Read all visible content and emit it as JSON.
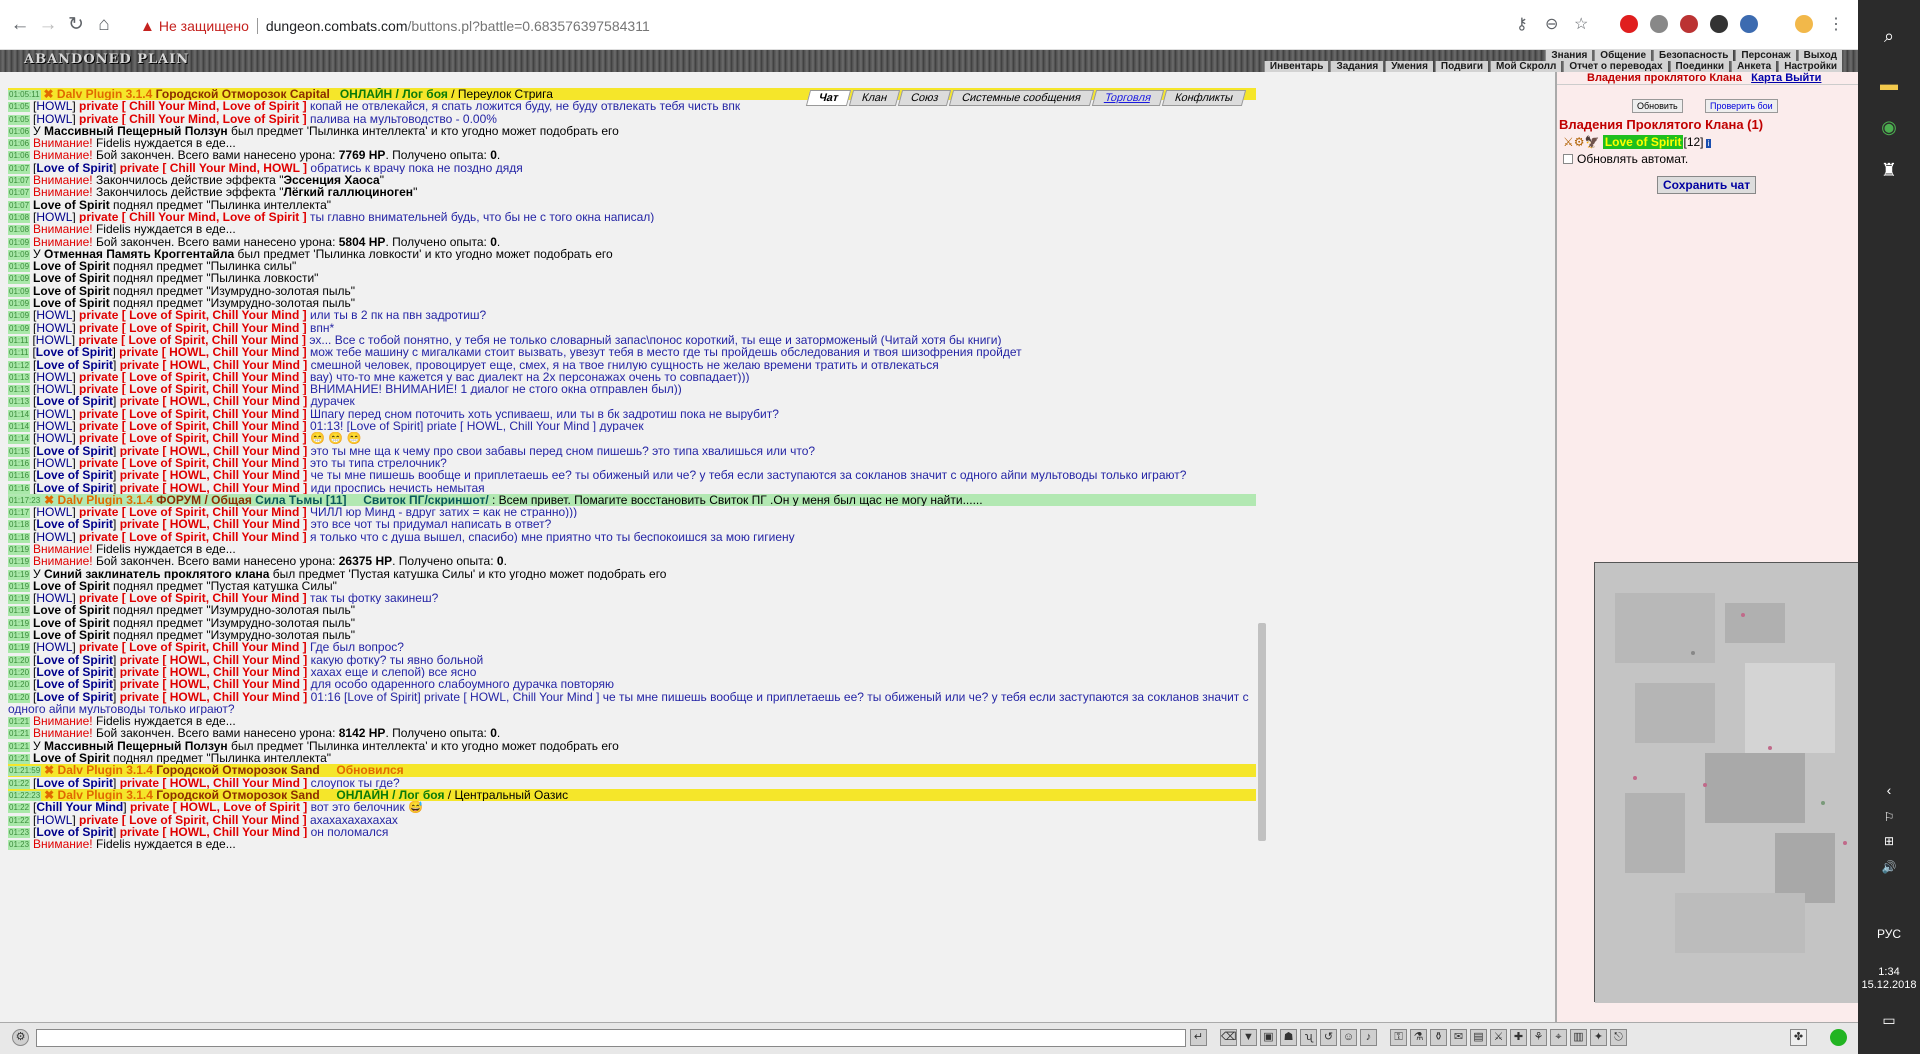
{
  "browser": {
    "not_secure": "Не защищено",
    "url_host": "dungeon.combats.com",
    "url_rest": "/buttons.pl?battle=0.683576397584311"
  },
  "game": {
    "logo": "ABANDONED PLAIN",
    "menu_row1": [
      "Знания",
      "Общение",
      "Безопасность",
      "Персонаж",
      "Выход"
    ],
    "menu_row2": [
      "Инвентарь",
      "Задания",
      "Умения",
      "Подвиги",
      "Мой Скролл",
      "Отчет о переводах",
      "Поединки",
      "Анкета",
      "Настройки"
    ]
  },
  "tabs": [
    "Чат",
    "Клан",
    "Союз",
    "Системные сообщения",
    "Торговля",
    "Конфликты"
  ],
  "chat": [
    {
      "t": "01:05:11",
      "cls": "hl",
      "html": "<span class='orn'>✖ Dalv Plugin 3.1.4</span> <span class='drk'>Городской Отморозок Capital</span> &nbsp; <span class='grn'>ОНЛАЙН / Лог боя</span> / Переулок Стрига"
    },
    {
      "t": "01:05",
      "html": "[<span class='nm'>HOWL</span>] <span class='red'>private [ Chill Your Mind, Love of Spirit ]</span> <span class='blue'>копай не отвлекайся, я спать ложится буду, не буду отвлекать тебя чисть впк</span>"
    },
    {
      "t": "01:05",
      "html": "[<span class='nm'>HOWL</span>] <span class='red'>private [ Chill Your Mind, Love of Spirit ]</span> <span class='blue'>палива на мультоводство - 0.00%</span>"
    },
    {
      "t": "01:06",
      "html": "У <b>Массивный Пещерный Ползун</b> был предмет 'Пылинка интеллекта' и кто угодно может подобрать его"
    },
    {
      "t": "01:06",
      "html": "<span class='red2'>Внимание!</span> Fidelis нуждается в еде..."
    },
    {
      "t": "01:06",
      "html": "<span class='red2'>Внимание!</span> Бой закончен. Всего вами нанесено урона: <b>7769 HP</b>. Получено опыта: <b>0</b>."
    },
    {
      "t": "01:07",
      "html": "[<span class='nm b'>Love of Spirit</span>] <span class='red'>private [ Chill Your Mind, HOWL ]</span> <span class='blue'>обратись к врачу пока не поздно дядя</span>"
    },
    {
      "t": "01:07",
      "html": "<span class='red2'>Внимание!</span> Закончилось действие эффекта \"<b>Эссенция Хаоса</b>\""
    },
    {
      "t": "01:07",
      "html": "<span class='red2'>Внимание!</span> Закончилось действие эффекта \"<b>Лёгкий галлюциноген</b>\""
    },
    {
      "t": "01:07",
      "html": "<b>Love of Spirit</b> поднял предмет \"Пылинка интеллекта\""
    },
    {
      "t": "01:08",
      "html": "[<span class='nm'>HOWL</span>] <span class='red'>private [ Chill Your Mind, Love of Spirit ]</span> <span class='blue'>ты главно внимательней будь, что бы не с того окна написал)</span>"
    },
    {
      "t": "01:08",
      "html": "<span class='red2'>Внимание!</span> Fidelis нуждается в еде..."
    },
    {
      "t": "01:09",
      "html": "<span class='red2'>Внимание!</span> Бой закончен. Всего вами нанесено урона: <b>5804 HP</b>. Получено опыта: <b>0</b>."
    },
    {
      "t": "01:09",
      "html": "У <b>Отменная Память Кроггентайла</b> был предмет 'Пылинка ловкости' и кто угодно может подобрать его"
    },
    {
      "t": "01:09",
      "html": "<b>Love of Spirit</b> поднял предмет \"Пылинка силы\""
    },
    {
      "t": "01:09",
      "html": "<b>Love of Spirit</b> поднял предмет \"Пылинка ловкости\""
    },
    {
      "t": "01:09",
      "html": "<b>Love of Spirit</b> поднял предмет \"Изумрудно-золотая пыль\""
    },
    {
      "t": "01:09",
      "html": "<b>Love of Spirit</b> поднял предмет \"Изумрудно-золотая пыль\""
    },
    {
      "t": "01:09",
      "html": "[<span class='nm'>HOWL</span>] <span class='red'>private [ Love of Spirit, Chill Your Mind ]</span> <span class='blue'>или ты в 2 пк на пвн задротиш?</span>"
    },
    {
      "t": "01:09",
      "html": "[<span class='nm'>HOWL</span>] <span class='red'>private [ Love of Spirit, Chill Your Mind ]</span> <span class='blue'>впн*</span>"
    },
    {
      "t": "01:11",
      "html": "[<span class='nm'>HOWL</span>] <span class='red'>private [ Love of Spirit, Chill Your Mind ]</span> <span class='blue'>эх... Все с тобой понятно, у тебя не только словарный запас\\понос короткий, ты еще и заторможеный (Читай хотя бы книги)</span>"
    },
    {
      "t": "01:11",
      "html": "[<span class='nm b'>Love of Spirit</span>] <span class='red'>private [ HOWL, Chill Your Mind ]</span> <span class='blue'>мож тебе машину с мигалками стоит вызвать, увезут тебя в место где ты пройдешь обследования и твоя шизофрения пройдет</span>"
    },
    {
      "t": "01:12",
      "html": "[<span class='nm b'>Love of Spirit</span>] <span class='red'>private [ HOWL, Chill Your Mind ]</span> <span class='blue'>смешной человек, провоцирует еще, смех, я на твое гнилую сущность не желаю времени тратить и отвлекаться</span>"
    },
    {
      "t": "01:13",
      "html": "[<span class='nm'>HOWL</span>] <span class='red'>private [ Love of Spirit, Chill Your Mind ]</span> <span class='blue'>вау) что-то мне кажется у вас диалект на 2х персонажах очень то совпадает)))</span>"
    },
    {
      "t": "01:13",
      "html": "[<span class='nm'>HOWL</span>] <span class='red'>private [ Love of Spirit, Chill Your Mind ]</span> <span class='blue'>ВНИМАНИЕ! ВНИМАНИЕ! 1 диалог не стого окна отправлен был))</span>"
    },
    {
      "t": "01:13",
      "html": "[<span class='nm b'>Love of Spirit</span>] <span class='red'>private [ HOWL, Chill Your Mind ]</span> <span class='blue'>дурачек</span>"
    },
    {
      "t": "01:14",
      "html": "[<span class='nm'>HOWL</span>] <span class='red'>private [ Love of Spirit, Chill Your Mind ]</span> <span class='blue'>Шпагу перед сном поточить хоть успиваеш, или ты в бк задротиш пока не вырубит?</span>"
    },
    {
      "t": "01:14",
      "html": "[<span class='nm'>HOWL</span>] <span class='red'>private [ Love of Spirit, Chill Your Mind ]</span> <span class='blue'>01:13! [Love of Spirit] priate [ HOWL, Chill Your Mind ] дурачек</span>"
    },
    {
      "t": "01:14",
      "html": "[<span class='nm'>HOWL</span>] <span class='red'>private [ Love of Spirit, Chill Your Mind ]</span> <span style='color:#1a8a8a'>😁 😁 😁</span>"
    },
    {
      "t": "01:15",
      "html": "[<span class='nm b'>Love of Spirit</span>] <span class='red'>private [ HOWL, Chill Your Mind ]</span> <span class='blue'>это ты мне ща к чему про свои забавы перед сном пишешь? это типа хвалишься или что?</span>"
    },
    {
      "t": "01:16",
      "html": "[<span class='nm'>HOWL</span>] <span class='red'>private [ Love of Spirit, Chill Your Mind ]</span> <span class='blue'>это ты типа стрелочник?</span>"
    },
    {
      "t": "01:16",
      "html": "[<span class='nm b'>Love of Spirit</span>] <span class='red'>private [ HOWL, Chill Your Mind ]</span> <span class='blue'>че ты мне пишешь вообще и приплетаешь ее? ты обиженый или че? у тебя если заступаются за сокланов значит с одного айпи мультоводы только играют?</span>"
    },
    {
      "t": "01:16",
      "html": "[<span class='nm b'>Love of Spirit</span>] <span class='red'>private [ HOWL, Chill Your Mind ]</span> <span class='blue'>иди проспись нечисть немытая</span>"
    },
    {
      "t": "01:17:23",
      "cls": "gr",
      "html": "<span class='orn'>✖ Dalv Plugin 3.1.4</span> <span class='drk'>ФОРУМ / Общая</span> <span style='color:#0a5a5a;font-weight:bold'>Сила Тьмы [11] &nbsp; &nbsp; Свиток ПГ/скриншот/</span> : Всем привет. Помагите восстановить Свиток ПГ .Он у меня был щас не могу найти......"
    },
    {
      "t": "01:17",
      "html": "[<span class='nm'>HOWL</span>] <span class='red'>private [ Love of Spirit, Chill Your Mind ]</span> <span class='blue'>ЧИЛЛ юр Минд - вдруг затих = как не странно)))</span>"
    },
    {
      "t": "01:18",
      "html": "[<span class='nm b'>Love of Spirit</span>] <span class='red'>private [ HOWL, Chill Your Mind ]</span> <span class='blue'>это все чот ты придумал написать в ответ?</span>"
    },
    {
      "t": "01:18",
      "html": "[<span class='nm'>HOWL</span>] <span class='red'>private [ Love of Spirit, Chill Your Mind ]</span> <span class='blue'>я только что с душа вышел, спасибо) мне приятно что ты беспокоишся за мою гигиену</span>"
    },
    {
      "t": "01:19",
      "html": "<span class='red2'>Внимание!</span> Fidelis нуждается в еде..."
    },
    {
      "t": "01:19",
      "html": "<span class='red2'>Внимание!</span> Бой закончен. Всего вами нанесено урона: <b>26375 HP</b>. Получено опыта: <b>0</b>."
    },
    {
      "t": "01:19",
      "html": "У <b>Синий заклинатель проклятого клана</b> был предмет 'Пустая катушка Силы' и кто угодно может подобрать его"
    },
    {
      "t": "01:19",
      "html": "<b>Love of Spirit</b> поднял предмет \"Пустая катушка Силы\""
    },
    {
      "t": "01:19",
      "html": "[<span class='nm'>HOWL</span>] <span class='red'>private [ Love of Spirit, Chill Your Mind ]</span> <span class='blue'>так ты фотку закинеш?</span>"
    },
    {
      "t": "01:19",
      "html": "<b>Love of Spirit</b> поднял предмет \"Изумрудно-золотая пыль\""
    },
    {
      "t": "01:19",
      "html": "<b>Love of Spirit</b> поднял предмет \"Изумрудно-золотая пыль\""
    },
    {
      "t": "01:19",
      "html": "<b>Love of Spirit</b> поднял предмет \"Изумрудно-золотая пыль\""
    },
    {
      "t": "01:19",
      "html": "[<span class='nm'>HOWL</span>] <span class='red'>private [ Love of Spirit, Chill Your Mind ]</span> <span class='blue'>Где был вопрос?</span>"
    },
    {
      "t": "01:20",
      "html": "[<span class='nm b'>Love of Spirit</span>] <span class='red'>private [ HOWL, Chill Your Mind ]</span> <span class='blue'>какую фотку? ты явно больной</span>"
    },
    {
      "t": "01:20",
      "html": "[<span class='nm b'>Love of Spirit</span>] <span class='red'>private [ HOWL, Chill Your Mind ]</span> <span class='blue'>хахах еще и слепой) все ясно</span>"
    },
    {
      "t": "01:20",
      "html": "[<span class='nm b'>Love of Spirit</span>] <span class='red'>private [ HOWL, Chill Your Mind ]</span> <span class='blue'>для особо одаренного слабоумного дурачка повторяю</span>"
    },
    {
      "t": "01:20",
      "cls": "tall",
      "html": "[<span class='nm b'>Love of Spirit</span>] <span class='red'>private [ HOWL, Chill Your Mind ]</span> <span class='blue'>01:16 [Love of Spirit] private [ HOWL, Chill Your Mind ] че ты мне пишешь вообще и приплетаешь ее? ты обиженый или че? у тебя если заступаются за сокланов значит с одного айпи мультоводы только играют?</span>"
    },
    {
      "t": "01:21",
      "html": "<span class='red2'>Внимание!</span> Fidelis нуждается в еде..."
    },
    {
      "t": "01:21",
      "html": "<span class='red2'>Внимание!</span> Бой закончен. Всего вами нанесено урона: <b>8142 HP</b>. Получено опыта: <b>0</b>."
    },
    {
      "t": "01:21",
      "html": "У <b>Массивный Пещерный Ползун</b> был предмет 'Пылинка интеллекта' и кто угодно может подобрать его"
    },
    {
      "t": "01:21",
      "html": "<b>Love of Spirit</b> поднял предмет \"Пылинка интеллекта\""
    },
    {
      "t": "01:21:59",
      "cls": "hl",
      "html": "<span class='orn'>✖ Dalv Plugin 3.1.4</span> <span class='drk'>Городской Отморозок Sand</span> &nbsp; &nbsp; <span class='orn'>Обновился</span>"
    },
    {
      "t": "01:22",
      "html": "[<span class='nm b'>Love of Spirit</span>] <span class='red'>private [ HOWL, Chill Your Mind ]</span> <span class='blue'>слоупок ты где?</span>"
    },
    {
      "t": "01:22:23",
      "cls": "hl",
      "html": "<span class='orn'>✖ Dalv Plugin 3.1.4</span> <span class='drk'>Городской Отморозок Sand</span> &nbsp; &nbsp; <span class='grn'>ОНЛАЙН / Лог боя</span> / Центральный Оазис"
    },
    {
      "t": "01:22",
      "html": "[<span class='nm b'>Chill Your Mind</span>] <span class='red'>private [ HOWL, Love of Spirit ]</span> <span class='blue'>вот это белочник</span> 😅"
    },
    {
      "t": "01:22",
      "html": "[<span class='nm'>HOWL</span>] <span class='red'>private [ Love of Spirit, Chill Your Mind ]</span> <span class='blue'>ахахахахахахах</span>"
    },
    {
      "t": "01:23",
      "html": "[<span class='nm b'>Love of Spirit</span>] <span class='red'>private [ HOWL, Chill Your Mind ]</span> <span class='blue'>он поломался</span>"
    },
    {
      "t": "01:23",
      "html": "<span class='red2'>Внимание!</span> Fidelis нуждается в еде..."
    }
  ],
  "right": {
    "header": "Владения проклятого Клана",
    "map_link": "Карта Выйти",
    "refresh": "Обновить",
    "check_fight": "Проверить бои",
    "title": "Владения Проклятого Клана (1)",
    "member_name": "Love of Spirit",
    "member_level": "[12]",
    "auto_refresh": "Обновлять автомат.",
    "save_chat": "Сохранить чат"
  },
  "taskbar": {
    "lang": "РУС",
    "time": "1:34",
    "date": "15.12.2018"
  }
}
